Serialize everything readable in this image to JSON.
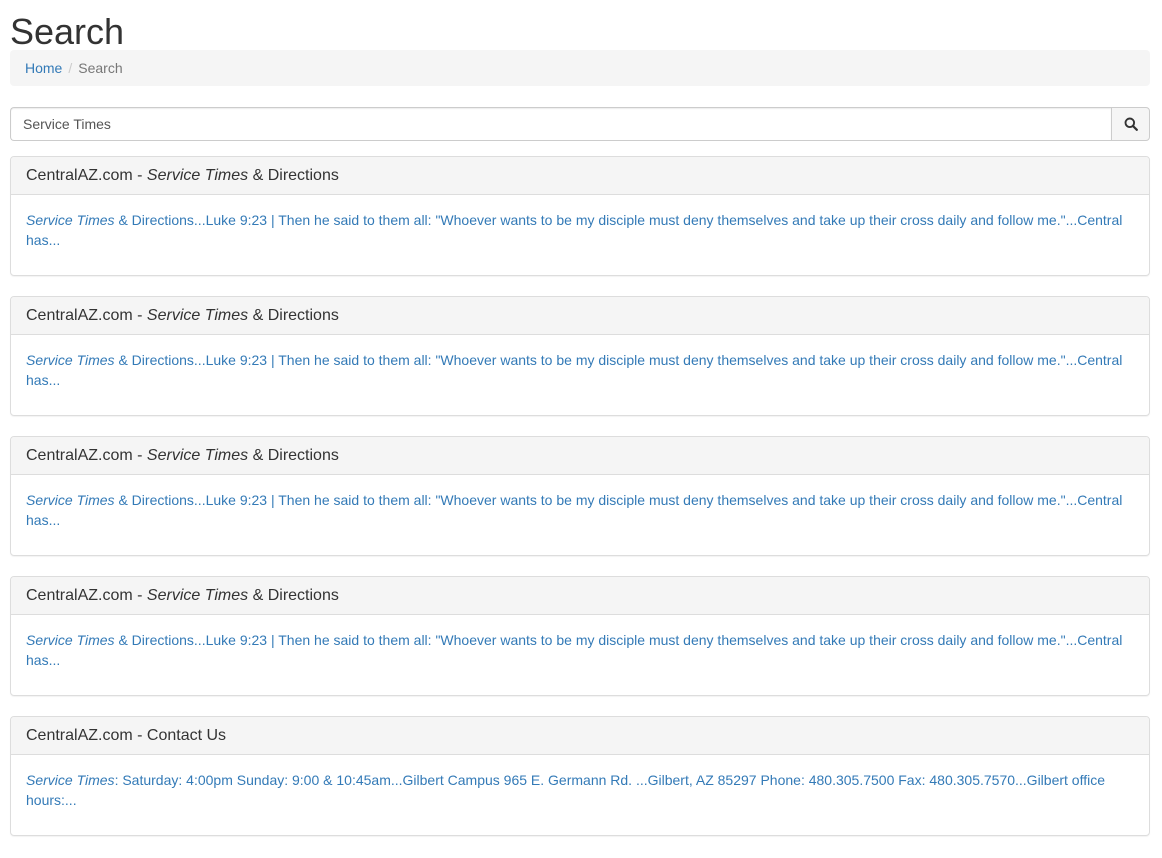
{
  "page": {
    "title": "Search"
  },
  "breadcrumb": {
    "home": "Home",
    "current": "Search"
  },
  "search": {
    "value": "Service Times",
    "button_icon": "search-icon"
  },
  "results": [
    {
      "title_prefix": "CentralAZ.com - ",
      "title_highlight": "Service Times",
      "title_suffix": " & Directions",
      "snippet_highlight": "Service Times",
      "snippet_text": " & Directions...Luke 9:23 | Then he said to them all: \"Whoever wants to be my disciple must deny themselves and take up their cross daily and follow me.\"...Central has..."
    },
    {
      "title_prefix": "CentralAZ.com - ",
      "title_highlight": "Service Times",
      "title_suffix": " & Directions",
      "snippet_highlight": "Service Times",
      "snippet_text": " & Directions...Luke 9:23 | Then he said to them all: \"Whoever wants to be my disciple must deny themselves and take up their cross daily and follow me.\"...Central has..."
    },
    {
      "title_prefix": "CentralAZ.com - ",
      "title_highlight": "Service Times",
      "title_suffix": " & Directions",
      "snippet_highlight": "Service Times",
      "snippet_text": " & Directions...Luke 9:23 | Then he said to them all: \"Whoever wants to be my disciple must deny themselves and take up their cross daily and follow me.\"...Central has..."
    },
    {
      "title_prefix": "CentralAZ.com - ",
      "title_highlight": "Service Times",
      "title_suffix": " & Directions",
      "snippet_highlight": "Service Times",
      "snippet_text": " & Directions...Luke 9:23 | Then he said to them all: \"Whoever wants to be my disciple must deny themselves and take up their cross daily and follow me.\"...Central has..."
    },
    {
      "title_prefix": "CentralAZ.com - Contact Us",
      "title_highlight": "",
      "title_suffix": "",
      "snippet_highlight": "Service Times",
      "snippet_text": ": Saturday: 4:00pm Sunday: 9:00 & 10:45am...Gilbert Campus 965 E. Germann Rd. ...Gilbert, AZ 85297 Phone: 480.305.7500 Fax: 480.305.7570...Gilbert office hours:..."
    }
  ],
  "colors": {
    "link": "#337ab7",
    "panel_heading_bg": "#f5f5f5",
    "border": "#dddddd"
  }
}
